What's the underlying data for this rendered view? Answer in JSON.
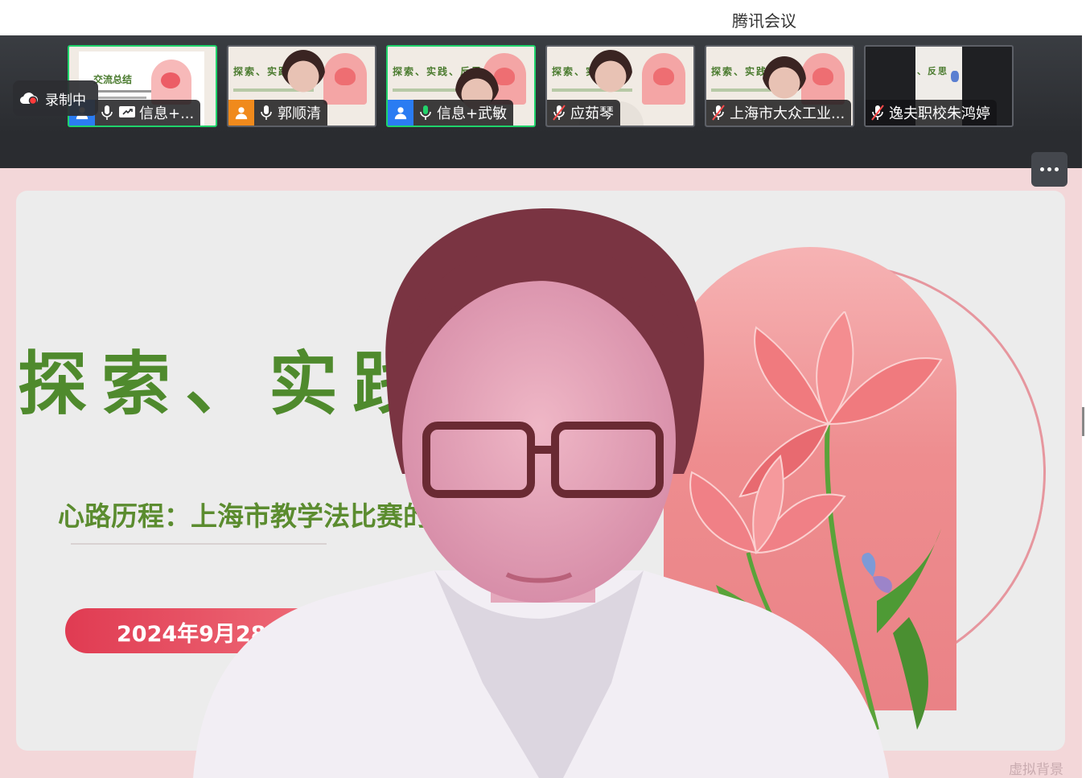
{
  "window": {
    "title": "腾讯会议"
  },
  "recording": {
    "label": "录制中"
  },
  "participants": [
    {
      "name": "信息+...",
      "avatar_color": "#2a7cf2",
      "mic": "on",
      "sharing": true,
      "active": true,
      "thumb_title": "交流总结"
    },
    {
      "name": "郭顺清",
      "avatar_color": "#f08a1c",
      "mic": "on",
      "sharing": false,
      "active": false,
      "thumb_title": "探索、实践"
    },
    {
      "name": "信息+武敏",
      "avatar_color": "#2a7cf2",
      "mic": "on",
      "sharing": false,
      "active": true,
      "thumb_title": "探索、实践、反思"
    },
    {
      "name": "应茹琴",
      "mic": "muted",
      "sharing": false,
      "active": false,
      "thumb_title": "探索、实"
    },
    {
      "name": "上海市大众工业...",
      "mic": "muted",
      "sharing": false,
      "active": false,
      "thumb_title": "探索、实践、"
    },
    {
      "name": "逸夫职校朱鸿婷",
      "mic": "muted",
      "sharing": false,
      "active": false,
      "thumb_title": "、反思"
    }
  ],
  "main": {
    "slide_title": "探索、实践",
    "slide_subtitle": "心路历程：上海市教学法比赛的",
    "slide_date": "2024年9月28日",
    "watermark": "虚拟背景",
    "accent_green": "#4f8a2d",
    "accent_pink": "#e03b52"
  },
  "icons": {
    "recording": "cloud-record-icon",
    "more": "more-dots-icon",
    "mic_on": "microphone-icon",
    "mic_muted": "microphone-muted-icon",
    "share": "screen-share-icon",
    "avatar": "user-icon"
  }
}
